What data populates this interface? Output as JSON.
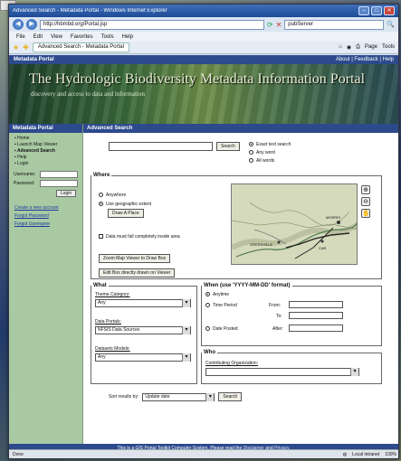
{
  "browser": {
    "title": "Advanced Search - Metadata Portal - Windows Internet Explorer",
    "url": "http://hbmbd.org/Portal.jsp",
    "search_value": "pubServer",
    "menu": [
      "File",
      "Edit",
      "View",
      "Favorites",
      "Tools",
      "Help"
    ],
    "tab_label": "Advanced Search - Metadata Portal",
    "tools": [
      "Page",
      "Tools"
    ],
    "status": "Done",
    "zone": "Local intranet",
    "zoom": "100%"
  },
  "site": {
    "home": "Metadata Portal",
    "toplinks": "About | Feedback | Help",
    "banner_title": "The Hydrologic Biodiversity Metadata Information Portal",
    "banner_subtitle": "discovery and access to data and information"
  },
  "sidebar": {
    "heading": "Metadata Portal",
    "items": [
      "Home",
      "Launch Map Viewer",
      "Advanced Search",
      "Help",
      "Login"
    ],
    "username_label": "Username:",
    "password_label": "Password:",
    "login_button": "Login",
    "links": [
      "Create a new account",
      "Forgot Password",
      "Forgot Username"
    ]
  },
  "main": {
    "heading": "Advanced Search",
    "search_button": "Search",
    "text_options": [
      "Exact text search",
      "Any word",
      "All words"
    ],
    "where": {
      "legend": "Where",
      "anywhere": "Anywhere",
      "geographic": "Use geographic extent",
      "draw_button": "Draw A Place",
      "data_must": "Data must fall completely inside area",
      "zoom_map_button": "Zoom Map Viewer to Draw Box",
      "edit_box_button": "Edit Box directly drawn on Viewer",
      "map_labels": [
        "MORRIS",
        "GREENVILLE",
        "CAR"
      ]
    },
    "what": {
      "legend": "What",
      "theme_label": "Theme Category:",
      "theme_value": "Any",
      "portal_label": "Data Portals:",
      "portal_value": "NFSIS Data Sources",
      "dataset_label": "Datasets Models:",
      "dataset_value": "Any"
    },
    "when": {
      "legend": "When (use 'YYYY-MM-DD' format)",
      "anytime": "Anytime",
      "time_period": "Time Period",
      "from": "From:",
      "to": "To:",
      "date_posted": "Date Posted",
      "after": "After:"
    },
    "who": {
      "legend": "Who",
      "org_label": "Contributing Organization:",
      "org_value": ""
    },
    "sort_label": "Sort results by:",
    "sort_value": "Update date",
    "sort_button": "Search"
  },
  "footer": {
    "text": "This is a GIS Portal Toolkit Computer System. Please read the",
    "disclaimer": "Disclaimer",
    "and": "and",
    "privacy": "Privacy."
  }
}
